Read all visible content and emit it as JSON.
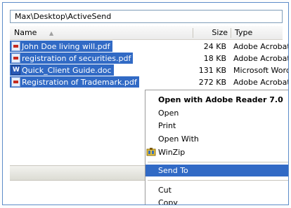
{
  "address": "Max\\Desktop\\ActiveSend",
  "columns": {
    "name": "Name",
    "sort_arrow": "▲",
    "size": "Size",
    "type": "Type"
  },
  "files": [
    {
      "name": "John Doe living will.pdf",
      "size": "24 KB",
      "type": "Adobe Acrobat",
      "icon": "pdf-file-icon"
    },
    {
      "name": "registration of securities.pdf",
      "size": "18 KB",
      "type": "Adobe Acrobat",
      "icon": "pdf-file-icon"
    },
    {
      "name": "Quick_Client Guide.doc",
      "size": "131 KB",
      "type": "Microsoft Word",
      "icon": "word-doc-icon"
    },
    {
      "name": "Registration of Trademark.pdf",
      "size": "272 KB",
      "type": "Adobe Acrobat",
      "icon": "pdf-file-icon"
    }
  ],
  "menu": {
    "open_with_default": "Open with Adobe Reader 7.0",
    "open": "Open",
    "print": "Print",
    "open_with": "Open With",
    "winzip": "WinZip",
    "send_to": "Send To",
    "cut": "Cut",
    "copy": "Copy"
  },
  "colors": {
    "selection": "#316ac5",
    "frame": "#5e8cc9"
  }
}
